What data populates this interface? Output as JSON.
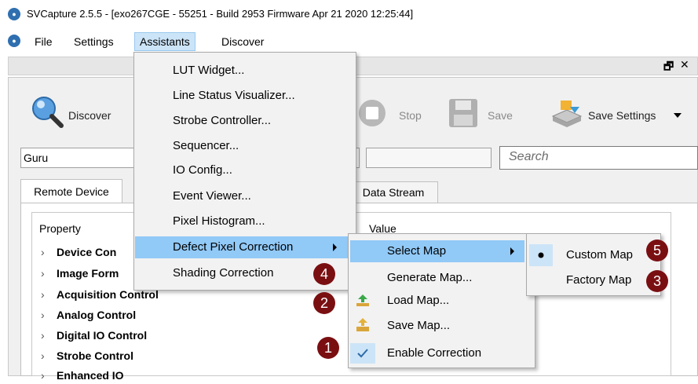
{
  "window": {
    "title": "SVCapture 2.5.5 - [exo267CGE - 55251 - Build 2953 Firmware Apr 21 2020 12:25:44]",
    "icon": "app-eye-icon"
  },
  "menubar": {
    "items": [
      "File",
      "Settings",
      "Assistants",
      "Discover"
    ],
    "active": "Assistants"
  },
  "dock_controls": {
    "float": "🗗",
    "close": "✕"
  },
  "toolbar": {
    "discover_label": "Discover",
    "stop_label": "Stop",
    "save_label": "Save",
    "save_settings_label": "Save Settings"
  },
  "filter": {
    "device_value": "Guru",
    "search_placeholder": "Search"
  },
  "tabs": [
    "Remote Device",
    "Data Stream"
  ],
  "grid": {
    "columns": [
      "Property",
      "Value"
    ],
    "rows": [
      "Device Con",
      "Image Form",
      "Acquisition Control",
      "Analog Control",
      "Digital IO Control",
      "Strobe Control",
      "Enhanced IO"
    ]
  },
  "assistants_menu": {
    "items": [
      "LUT Widget...",
      "Line Status Visualizer...",
      "Strobe Controller...",
      "Sequencer...",
      "IO Config...",
      "Event Viewer...",
      "Pixel Histogram...",
      "Defect Pixel Correction",
      "Shading Correction"
    ],
    "highlighted": "Defect Pixel Correction"
  },
  "dpc_submenu": {
    "items": [
      "Select Map",
      "Generate Map...",
      "Load Map...",
      "Save Map...",
      "Enable Correction"
    ],
    "highlighted": "Select Map"
  },
  "map_submenu": {
    "items": [
      "Custom Map",
      "Factory Map"
    ],
    "selected": "Custom Map"
  },
  "badges": [
    "1",
    "2",
    "3",
    "4",
    "5"
  ],
  "colors": {
    "badge": "#7a0f12",
    "menu_highlight": "#91c9f7",
    "menubar_active": "#cce4f7"
  }
}
